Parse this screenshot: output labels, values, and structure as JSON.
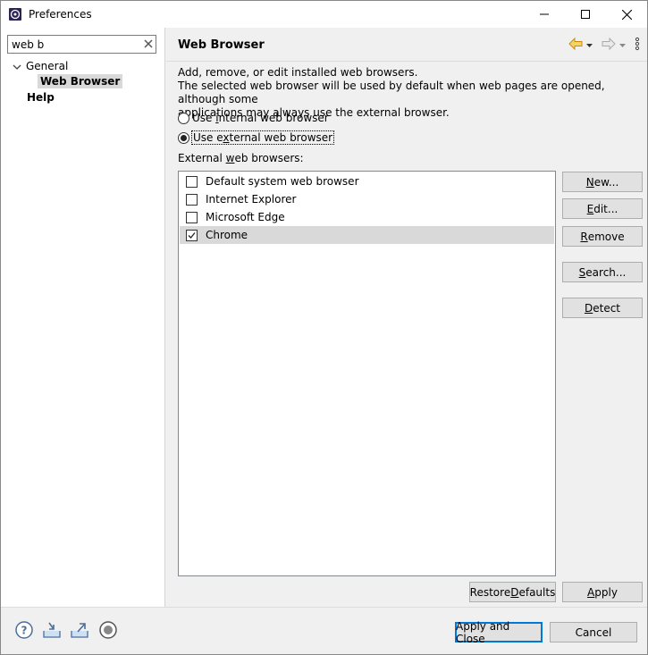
{
  "window": {
    "title": "Preferences"
  },
  "filter": {
    "value": "web b"
  },
  "tree": {
    "general": "General",
    "web_browser": "Web Browser",
    "help": "Help"
  },
  "page": {
    "title": "Web Browser",
    "description_line1": "Add, remove, or edit installed web browsers.",
    "description_line2": "The selected web browser will be used by default when web pages are opened, although some",
    "description_line3": "applications may always use the external browser.",
    "radio_internal": {
      "pre": "Use ",
      "mnemonic": "i",
      "post": "nternal web browser",
      "selected": false
    },
    "radio_external": {
      "pre": "Use e",
      "mnemonic": "x",
      "post": "ternal web browser",
      "selected": true
    },
    "list_label": {
      "pre": "External ",
      "mnemonic": "w",
      "post": "eb browsers:"
    },
    "browsers": [
      {
        "name": "Default system web browser",
        "checked": false
      },
      {
        "name": "Internet Explorer",
        "checked": false
      },
      {
        "name": "Microsoft Edge",
        "checked": false
      },
      {
        "name": "Chrome",
        "checked": true
      }
    ],
    "buttons": {
      "new": {
        "mnemonic": "N",
        "rest": "ew..."
      },
      "edit": {
        "mnemonic": "E",
        "rest": "dit..."
      },
      "remove": {
        "mnemonic": "R",
        "rest": "emove"
      },
      "search": {
        "mnemonic": "S",
        "rest": "earch..."
      },
      "detect": {
        "mnemonic": "D",
        "rest": "etect"
      }
    },
    "restore_defaults": {
      "pre": "Restore ",
      "mnemonic": "D",
      "post": "efaults"
    },
    "apply": {
      "mnemonic": "A",
      "rest": "pply"
    }
  },
  "dialog_buttons": {
    "apply_and_close": "Apply and Close",
    "cancel": "Cancel"
  },
  "colors": {
    "selection": "#d9d9d9",
    "accent": "#0078d7",
    "nav_back": "#e8a317"
  }
}
